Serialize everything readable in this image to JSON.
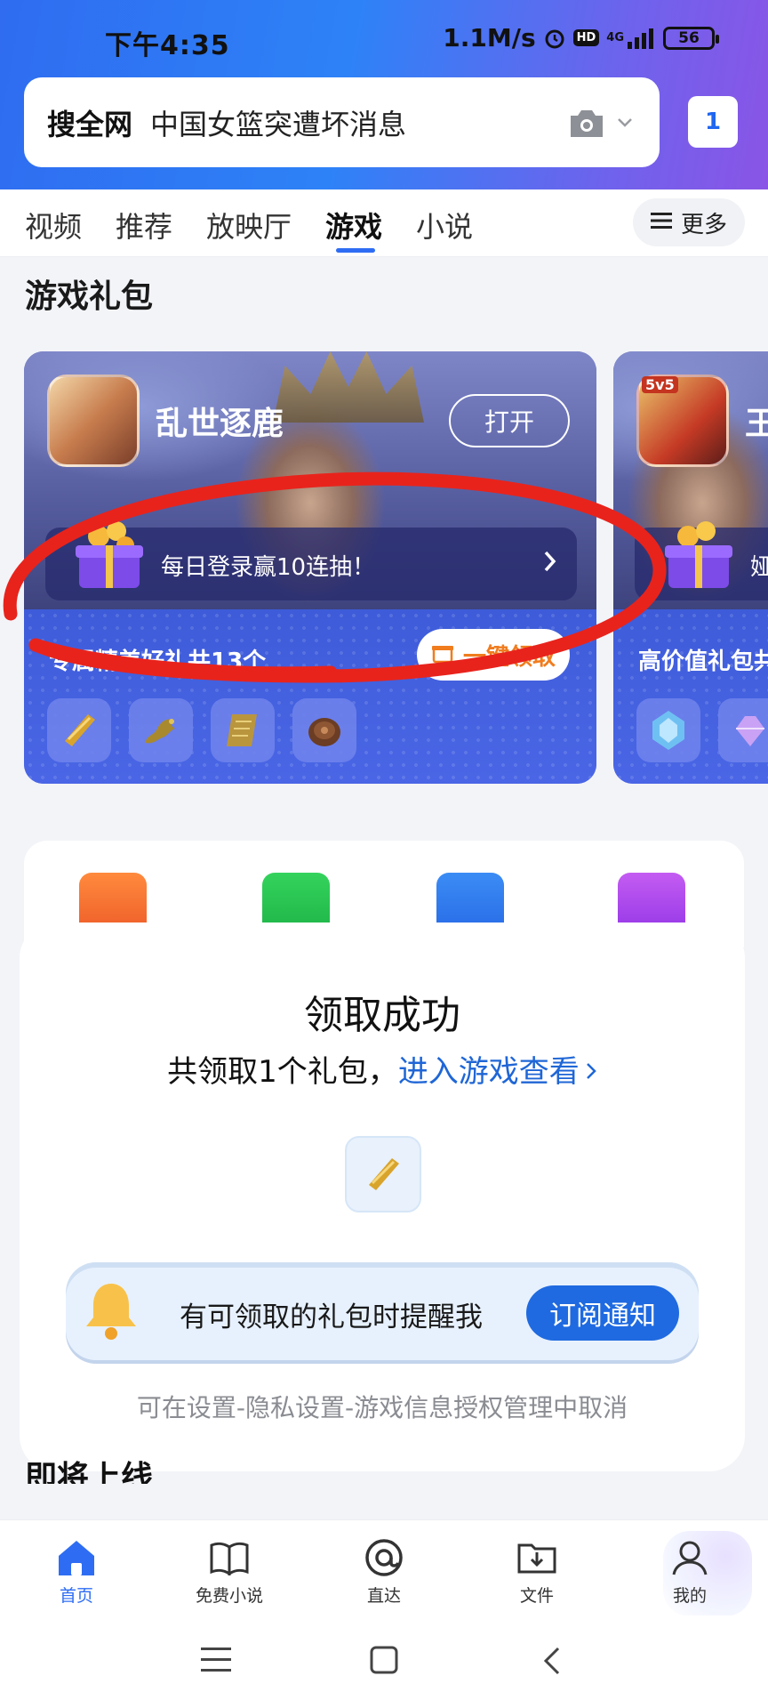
{
  "status": {
    "time": "下午4:35",
    "speed": "1.1M/s",
    "network": "4G",
    "battery": "56"
  },
  "search": {
    "scope": "搜全网",
    "query": "中国女篮突遭坏消息",
    "tab_count": "1"
  },
  "tabs": [
    {
      "label": "视频"
    },
    {
      "label": "推荐"
    },
    {
      "label": "放映厅"
    },
    {
      "label": "游戏"
    },
    {
      "label": "小说"
    }
  ],
  "more_label": "更多",
  "section_title": "游戏礼包",
  "cards": [
    {
      "game": "乱世逐鹿",
      "open_label": "打开",
      "daily": "每日登录赢10连抽！",
      "gift_count": "专属精美好礼共13个",
      "claim_label": "一键领取"
    },
    {
      "game": "王",
      "avatar_tag": "5v5",
      "daily": "娅",
      "gift_count": "高价值礼包共"
    }
  ],
  "dialog": {
    "title": "领取成功",
    "sub_prefix": "共领取1个礼包，",
    "sub_link": "进入游戏查看",
    "notify_text": "有可领取的礼包时提醒我",
    "subscribe_label": "订阅通知",
    "footnote": "可在设置-隐私设置-游戏信息授权管理中取消"
  },
  "next_section": "即将上线",
  "bottom_nav": [
    {
      "label": "首页"
    },
    {
      "label": "免费小说"
    },
    {
      "label": "直达"
    },
    {
      "label": "文件"
    },
    {
      "label": "我的"
    }
  ],
  "colors": {
    "accent": "#2e6df3",
    "annotation": "#e8231c",
    "claim": "#f07c1e"
  }
}
